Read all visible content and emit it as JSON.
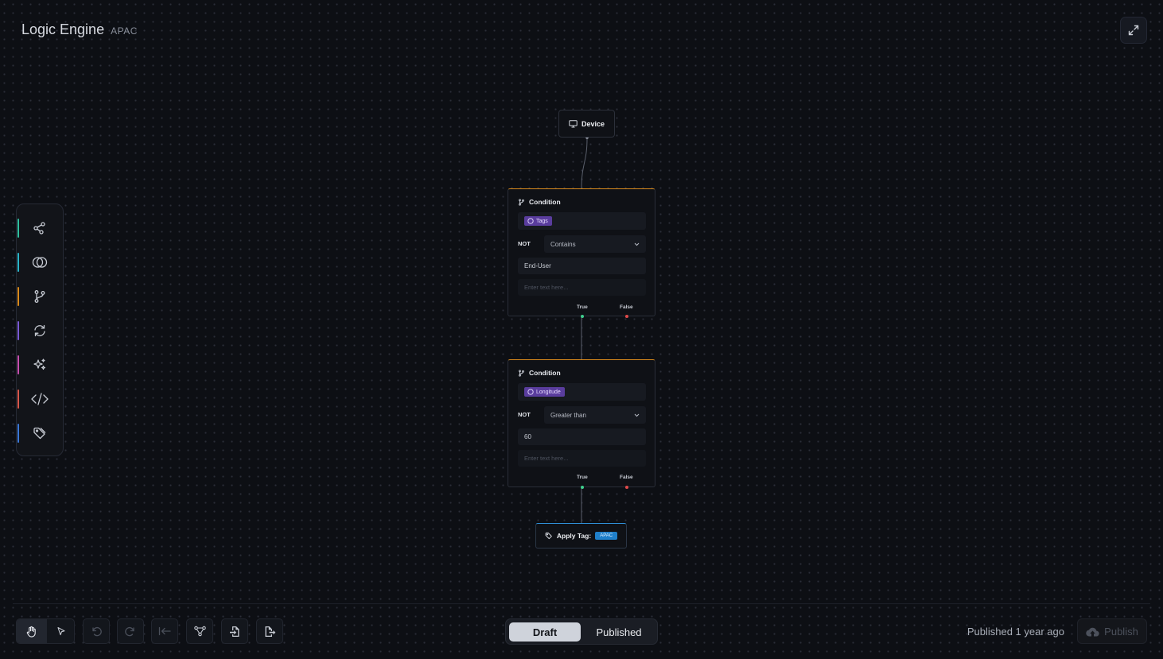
{
  "header": {
    "title": "Logic Engine",
    "region": "APAC"
  },
  "palette": {
    "items": [
      {
        "icon": "share-nodes-icon",
        "color": "#2fbfa0"
      },
      {
        "icon": "overlap-circles-icon",
        "color": "#2ab5c9"
      },
      {
        "icon": "git-branch-icon",
        "color": "#d98a1c"
      },
      {
        "icon": "refresh-icon",
        "color": "#7a5ad6"
      },
      {
        "icon": "sparkles-icon",
        "color": "#c74fb0"
      },
      {
        "icon": "code-icon",
        "color": "#d8574b"
      },
      {
        "icon": "tag-icon",
        "color": "#3a78d8"
      }
    ]
  },
  "nodes": {
    "device": {
      "label": "Device"
    },
    "condition1": {
      "title": "Condition",
      "field": "Tags",
      "not_label": "NOT",
      "operator": "Contains",
      "value": "End-User",
      "text_placeholder": "Enter text here...",
      "true_label": "True",
      "false_label": "False"
    },
    "condition2": {
      "title": "Condition",
      "field": "Longitude",
      "not_label": "NOT",
      "operator": "Greater than",
      "value": "60",
      "text_placeholder": "Enter text here...",
      "true_label": "True",
      "false_label": "False"
    },
    "apply_tag": {
      "label": "Apply Tag:",
      "tag": "APAC"
    }
  },
  "version_toggle": {
    "draft": "Draft",
    "published": "Published",
    "selected": "Draft"
  },
  "status": {
    "published_text": "Published 1 year ago"
  },
  "publish_button": {
    "label": "Publish"
  },
  "colors": {
    "condition_accent": "#d98a1c",
    "apply_accent": "#2f8fd6",
    "chip_purple": "#5a3d9e",
    "true_handle": "#3fcf8e",
    "false_handle": "#e04a4a"
  }
}
